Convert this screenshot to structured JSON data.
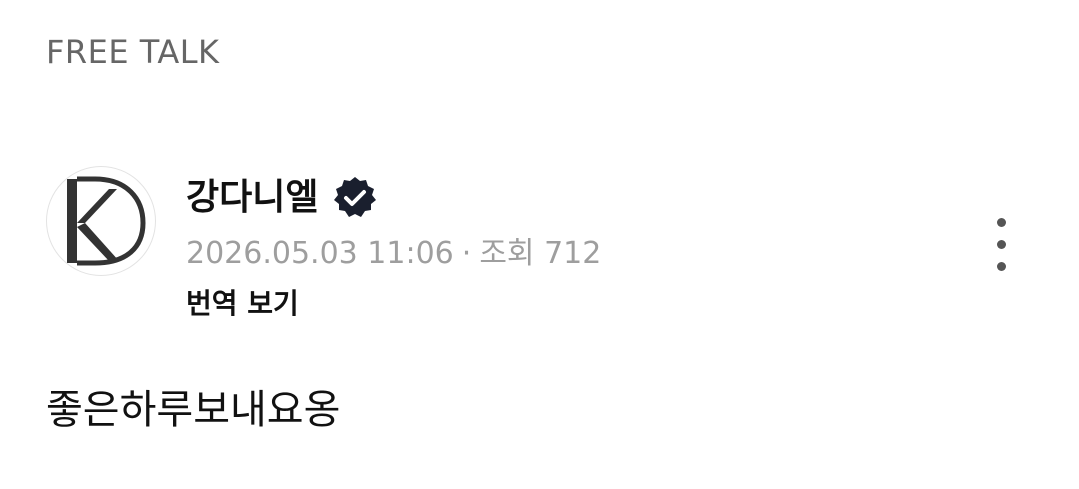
{
  "board": {
    "title": "FREE TALK"
  },
  "post": {
    "author": {
      "name": "강다니엘",
      "verified": true,
      "avatar_icon": "kd-monogram-logo"
    },
    "date": "2026.05.03 11:06",
    "separator": "·",
    "views_label": "조회",
    "views": "712",
    "translate_label": "번역 보기",
    "more_icon": "more-vertical-icon",
    "body": "좋은하루보내요옹"
  },
  "colors": {
    "title": "#666666",
    "meta": "#9e9e9e",
    "text": "#111111",
    "badge": "#1a1f2e"
  }
}
